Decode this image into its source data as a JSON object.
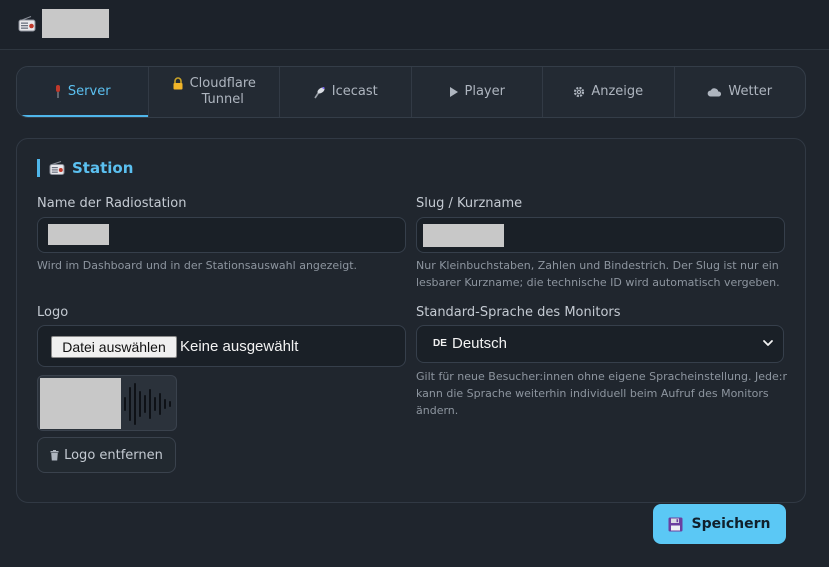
{
  "header": {
    "app_icon": "radio-icon",
    "title_redacted": true
  },
  "tabs": [
    {
      "id": "server",
      "icon": "microphone-icon",
      "label": "Server",
      "active": true
    },
    {
      "id": "cloudflare",
      "icon": "lock-icon",
      "label_line1": "Cloudflare",
      "label_line2": "Tunnel",
      "active": false
    },
    {
      "id": "icecast",
      "icon": "broadcast-icon",
      "label": "Icecast",
      "active": false
    },
    {
      "id": "player",
      "icon": "play-icon",
      "label": "Player",
      "active": false
    },
    {
      "id": "anzeige",
      "icon": "gear-icon",
      "label": "Anzeige",
      "active": false
    },
    {
      "id": "wetter",
      "icon": "cloud-icon",
      "label": "Wetter",
      "active": false
    }
  ],
  "station": {
    "section_title": "Station",
    "name_label": "Name der Radiostation",
    "name_hint": "Wird im Dashboard und in der Stationsauswahl angezeigt.",
    "slug_label": "Slug / Kurzname",
    "slug_hint_line1": "Nur Kleinbuchstaben, Zahlen und Bindestrich. Der Slug ist nur ein",
    "slug_hint_line2": "lesbarer Kurzname; die technische ID wird automatisch vergeben.",
    "logo_label": "Logo",
    "file_button": "Datei auswählen",
    "file_status": "Keine ausgewählt",
    "remove_logo": "Logo entfernen",
    "language_label": "Standard-Sprache des Monitors",
    "language_flag": "DE",
    "language_value": "Deutsch",
    "language_hint_line1": "Gilt für neue Besucher:innen ohne eigene Spracheinstellung. Jede:r",
    "language_hint_line2": "kann die Sprache weiterhin individuell beim Aufruf des Monitors",
    "language_hint_line3": "ändern."
  },
  "actions": {
    "save_label": "Speichern"
  },
  "colors": {
    "accent": "#5bc0f0",
    "save_button": "#5bc8f5",
    "background": "#1f252d"
  }
}
